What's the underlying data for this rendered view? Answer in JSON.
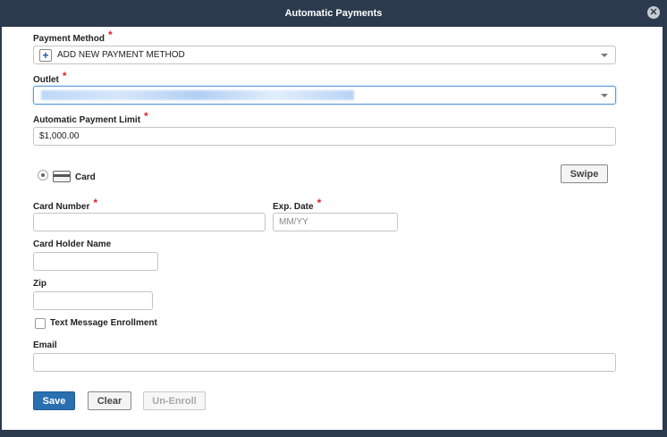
{
  "dialog": {
    "title": "Automatic Payments",
    "close_icon": "close-circle-icon"
  },
  "payment_method": {
    "label": "Payment Method",
    "value": "ADD NEW PAYMENT METHOD",
    "icon": "plus-icon"
  },
  "outlet": {
    "label": "Outlet"
  },
  "payment_limit": {
    "label": "Automatic Payment Limit",
    "value": "$1,000.00"
  },
  "card_option": {
    "label": "Card",
    "selected": true
  },
  "swipe": {
    "label": "Swipe"
  },
  "card_number": {
    "label": "Card Number",
    "value": ""
  },
  "exp_date": {
    "label": "Exp. Date",
    "placeholder": "MM/YY"
  },
  "card_holder": {
    "label": "Card Holder Name",
    "value": ""
  },
  "zip": {
    "label": "Zip",
    "value": ""
  },
  "text_enrollment": {
    "label": "Text Message Enrollment",
    "checked": false
  },
  "email": {
    "label": "Email",
    "value": ""
  },
  "actions": {
    "save": "Save",
    "clear": "Clear",
    "unenroll": "Un-Enroll"
  },
  "colors": {
    "header": "#2b3a4d",
    "primary": "#2a6fb0",
    "required": "#d9262f"
  }
}
